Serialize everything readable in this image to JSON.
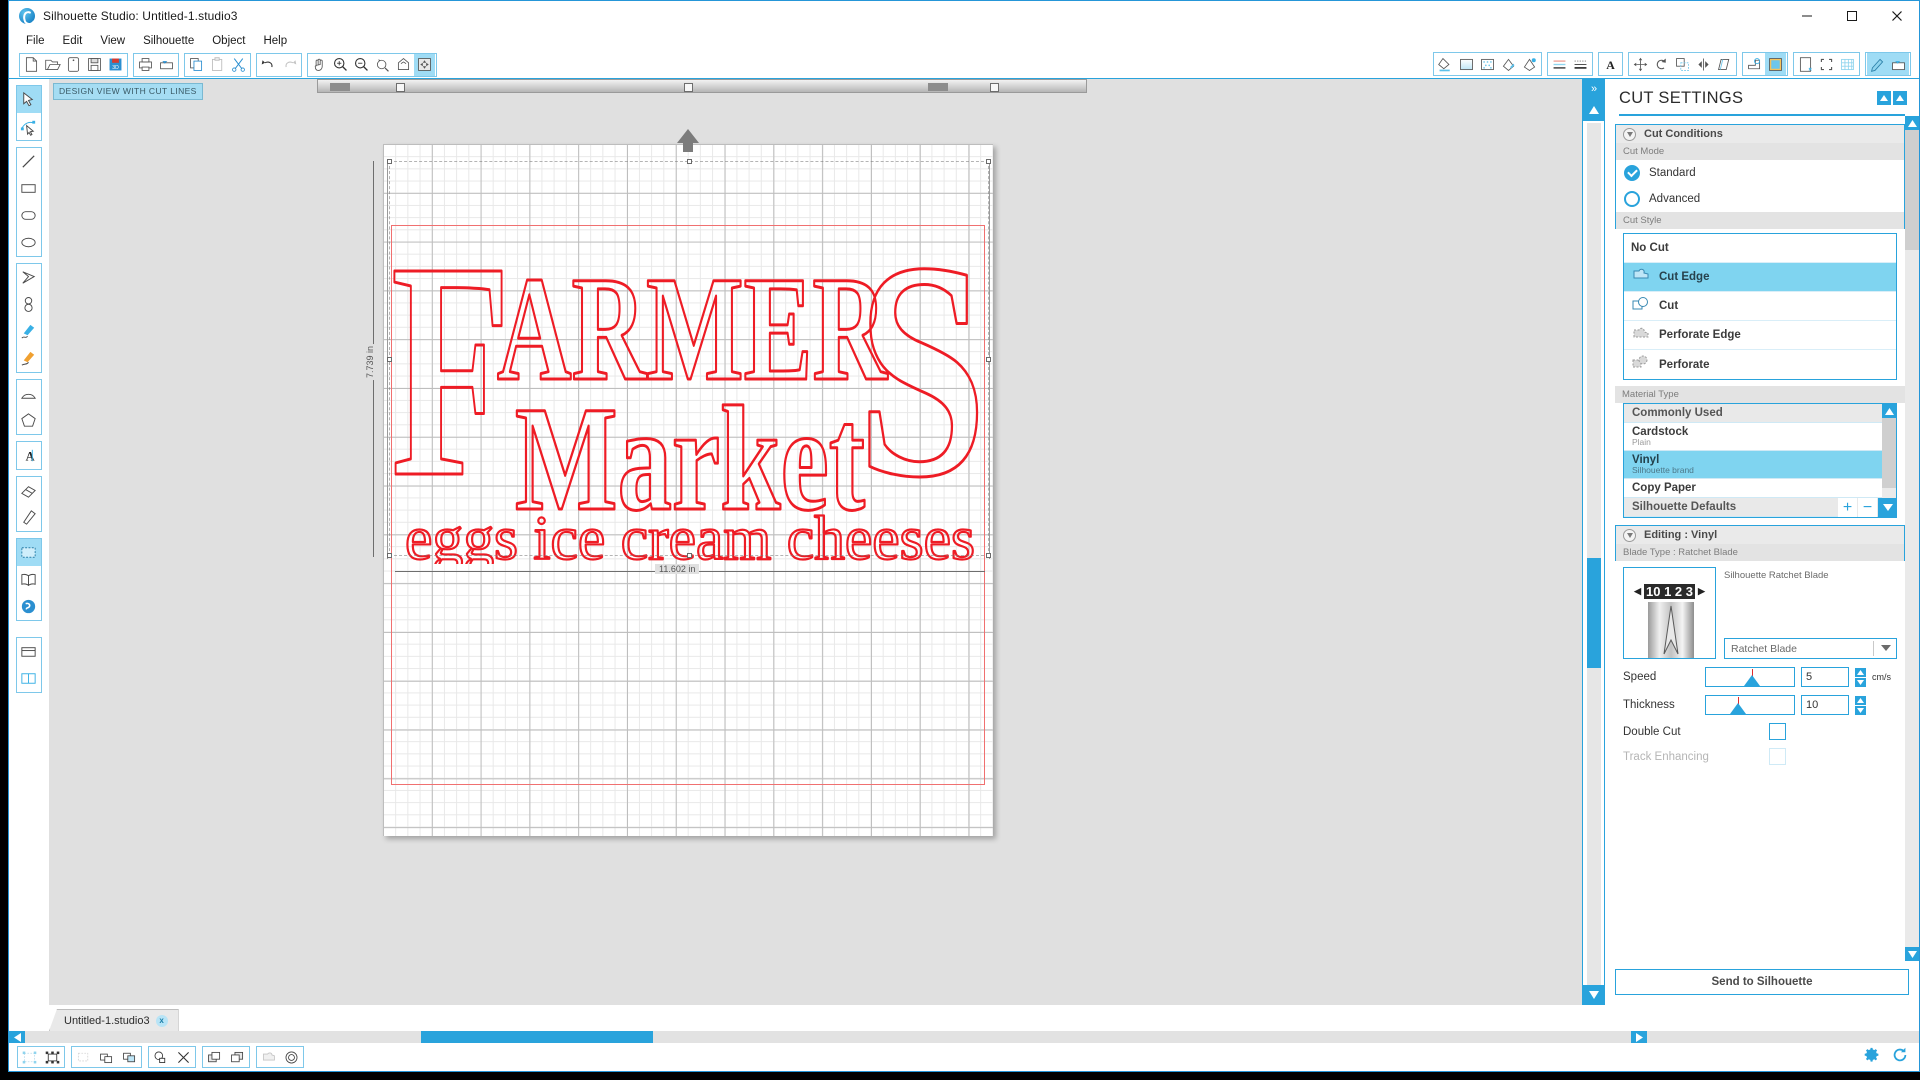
{
  "window": {
    "title": "Silhouette Studio: Untitled-1.studio3",
    "minimize_label": "Minimize",
    "maximize_label": "Maximize",
    "close_label": "Close"
  },
  "menu": {
    "items": [
      "File",
      "Edit",
      "View",
      "Silhouette",
      "Object",
      "Help"
    ]
  },
  "toolbar": {
    "left_groups": [
      {
        "icons": [
          "new-document-icon",
          "open-folder-icon",
          "new-from-template-icon",
          "save-icon",
          "save-to-library-icon"
        ]
      },
      {
        "icons": [
          "print-icon",
          "send-to-cutter-icon"
        ]
      },
      {
        "icons": [
          "copy-icon",
          "paste-icon",
          "cut-scissors-icon"
        ]
      },
      {
        "icons": [
          "undo-icon",
          "redo-icon"
        ]
      },
      {
        "icons": [
          "pan-hand-icon",
          "zoom-in-icon",
          "zoom-out-icon",
          "zoom-selection-icon",
          "zoom-fit-icon",
          "zoom-all-icon"
        ]
      }
    ],
    "right_groups": [
      {
        "icons": [
          "fill-color-icon",
          "gradient-fill-icon",
          "pattern-fill-icon",
          "line-color-icon",
          "sketch-pen-icon"
        ]
      },
      {
        "icons": [
          "line-style-icon",
          "line-thickness-icon"
        ]
      },
      {
        "icons": [
          "text-style-icon"
        ]
      },
      {
        "icons": [
          "move-transform-icon",
          "rotate-icon",
          "scale-icon",
          "mirror-icon",
          "shear-icon"
        ]
      },
      {
        "icons": [
          "offset-icon",
          "trace-icon"
        ]
      },
      {
        "icons": [
          "page-setup-icon",
          "registration-marks-icon",
          "grid-icon"
        ]
      },
      {
        "icons": [
          "design-pen-icon",
          "send-panel-icon"
        ]
      }
    ]
  },
  "left_rail": {
    "groups": [
      {
        "tools": [
          {
            "name": "select-tool",
            "selected": true
          },
          {
            "name": "edit-points-tool",
            "selected": false
          }
        ]
      },
      {
        "tools": [
          {
            "name": "line-tool",
            "selected": false
          },
          {
            "name": "rectangle-tool",
            "selected": false
          },
          {
            "name": "rounded-rectangle-tool",
            "selected": false
          },
          {
            "name": "ellipse-tool",
            "selected": false
          }
        ]
      },
      {
        "tools": [
          {
            "name": "polygon-tool",
            "selected": false
          },
          {
            "name": "curve-shape-tool",
            "selected": false
          },
          {
            "name": "draw-freehand-tool",
            "selected": false
          },
          {
            "name": "draw-smooth-tool",
            "selected": false
          }
        ]
      },
      {
        "tools": [
          {
            "name": "arc-tool",
            "selected": false
          },
          {
            "name": "regular-polygon-tool",
            "selected": false
          }
        ]
      },
      {
        "tools": [
          {
            "name": "text-tool",
            "selected": false
          }
        ]
      },
      {
        "tools": [
          {
            "name": "eraser-tool",
            "selected": false
          },
          {
            "name": "knife-tool",
            "selected": false
          }
        ]
      },
      {
        "tools": [
          {
            "name": "page-view-tool",
            "selected": true
          },
          {
            "name": "library-tool",
            "selected": false
          },
          {
            "name": "silhouette-store-tool",
            "selected": false
          }
        ]
      },
      {
        "tools": [
          {
            "name": "panel-layout-tool",
            "selected": false
          },
          {
            "name": "split-view-tool",
            "selected": false
          }
        ]
      }
    ]
  },
  "canvas": {
    "view_badge": "DESIGN VIEW WITH CUT LINES",
    "dimension_width": "11.602 in",
    "dimension_height": "7.739 in",
    "cut_line_color": "#ee1c25",
    "artwork": {
      "big_letter_left": "F",
      "big_letter_right": "S",
      "line1": "ARMER",
      "line2": "Market",
      "line3": "eggs  ice cream cheeses"
    }
  },
  "right_panel": {
    "title": "CUT SETTINGS",
    "header_buttons": [
      "collapse-up-icon",
      "restore-icon"
    ],
    "cut_conditions": {
      "section_title": "Cut Conditions",
      "cut_mode_label": "Cut Mode",
      "modes": [
        {
          "label": "Standard",
          "selected": true
        },
        {
          "label": "Advanced",
          "selected": false
        }
      ],
      "cut_style_label": "Cut Style",
      "styles": [
        {
          "label": "No Cut",
          "icon": "no-cut-icon",
          "selected": false
        },
        {
          "label": "Cut Edge",
          "icon": "cut-edge-icon",
          "selected": true
        },
        {
          "label": "Cut",
          "icon": "cut-icon",
          "selected": false
        },
        {
          "label": "Perforate Edge",
          "icon": "perforate-edge-icon",
          "selected": false
        },
        {
          "label": "Perforate",
          "icon": "perforate-icon",
          "selected": false
        }
      ],
      "material_type_label": "Material Type",
      "materials": [
        {
          "name": "Commonly Used",
          "sub": "",
          "group": true,
          "selected": false
        },
        {
          "name": "Cardstock",
          "sub": "Plain",
          "group": false,
          "selected": false
        },
        {
          "name": "Vinyl",
          "sub": "Silhouette brand",
          "group": false,
          "selected": true
        },
        {
          "name": "Copy Paper",
          "sub": "",
          "group": false,
          "selected": false
        },
        {
          "name": "Silhouette Defaults",
          "sub": "",
          "group": true,
          "selected": false
        }
      ],
      "add_label": "+",
      "remove_label": "−"
    },
    "editing": {
      "section_title": "Editing : Vinyl",
      "blade_type_label": "Blade Type : Ratchet Blade",
      "blade_name": "Silhouette Ratchet Blade",
      "blade_numbers": "10 1 2 3",
      "blade_select_value": "Ratchet Blade",
      "speed_label": "Speed",
      "speed_value": "5",
      "speed_unit": "cm/s",
      "thickness_label": "Thickness",
      "thickness_value": "10",
      "double_cut_label": "Double Cut",
      "double_cut_checked": false,
      "track_enhancing_label": "Track Enhancing",
      "track_enhancing_checked": false,
      "track_enhancing_disabled": true
    },
    "send_button": "Send to Silhouette"
  },
  "bottom": {
    "tab_name": "Untitled-1.studio3",
    "tab_close": "x",
    "status_groups": [
      {
        "icons": [
          "select-all-icon",
          "select-none-icon"
        ]
      },
      {
        "icons": [
          "group-icon",
          "ungroup-icon",
          "group-layers-icon"
        ]
      },
      {
        "icons": [
          "weld-icon",
          "subtract-icon"
        ]
      },
      {
        "icons": [
          "bring-to-front-icon",
          "send-to-back-icon"
        ]
      },
      {
        "icons": [
          "offset-shape-icon",
          "internal-offset-icon"
        ]
      }
    ],
    "right_icons": [
      "settings-gear-icon",
      "sync-icon"
    ]
  }
}
